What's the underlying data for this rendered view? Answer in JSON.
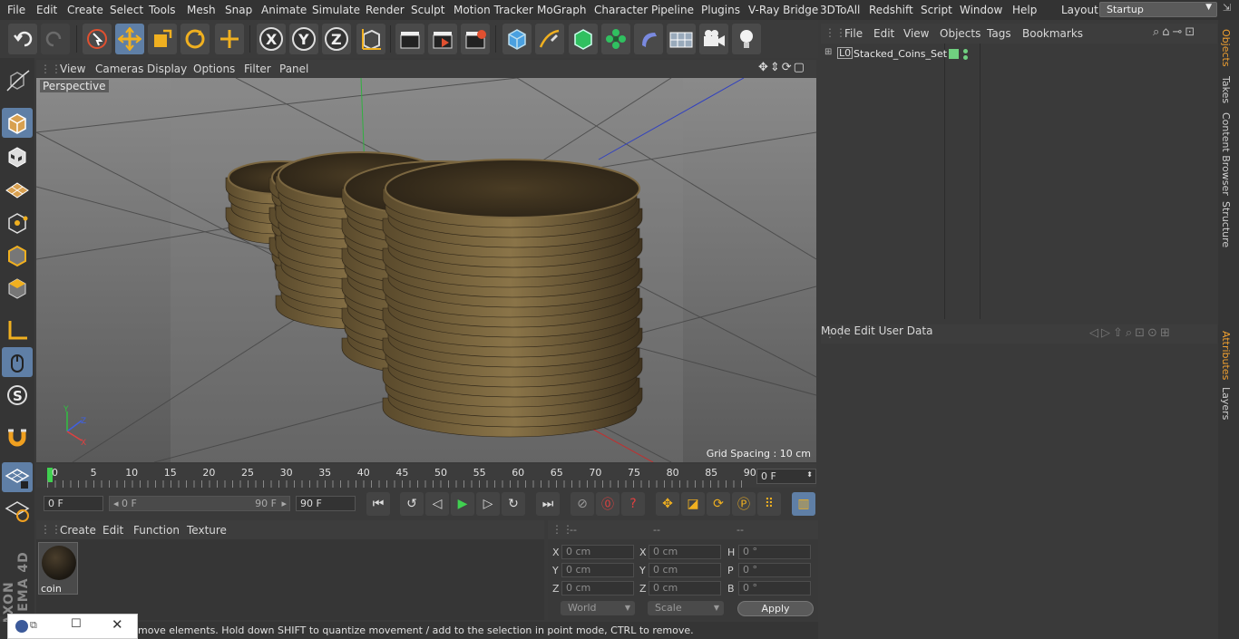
{
  "menu": [
    "File",
    "Edit",
    "Create",
    "Select",
    "Tools",
    "Mesh",
    "Snap",
    "Animate",
    "Simulate",
    "Render",
    "Sculpt",
    "Motion Tracker",
    "MoGraph",
    "Character",
    "Pipeline",
    "Plugins",
    "V-Ray Bridge",
    "3DToAll",
    "Redshift",
    "Script",
    "Window",
    "Help"
  ],
  "layout": {
    "label": "Layout:",
    "value": "Startup"
  },
  "viewport": {
    "menu": [
      "View",
      "Cameras",
      "Display",
      "Options",
      "Filter",
      "Panel"
    ],
    "label": "Perspective",
    "grid_spacing": "Grid Spacing : 10 cm"
  },
  "timeline": {
    "ticks": [
      "0",
      "5",
      "10",
      "15",
      "20",
      "25",
      "30",
      "35",
      "40",
      "45",
      "50",
      "55",
      "60",
      "65",
      "70",
      "75",
      "80",
      "85",
      "90"
    ],
    "current_frame": "0 F"
  },
  "controls": {
    "start": "0 F",
    "range_start": "0 F",
    "range_end": "90 F",
    "end": "90 F"
  },
  "material_manager": {
    "menu": [
      "Create",
      "Edit",
      "Function",
      "Texture"
    ],
    "material_name": "coin"
  },
  "coordinates": {
    "headers": [
      "--",
      "--",
      "--"
    ],
    "rows": [
      {
        "a": "X",
        "av": "0 cm",
        "b": "X",
        "bv": "0 cm",
        "c": "H",
        "cv": "0 °"
      },
      {
        "a": "Y",
        "av": "0 cm",
        "b": "Y",
        "bv": "0 cm",
        "c": "P",
        "cv": "0 °"
      },
      {
        "a": "Z",
        "av": "0 cm",
        "b": "Z",
        "bv": "0 cm",
        "c": "B",
        "cv": "0 °"
      }
    ],
    "world": "World",
    "scale": "Scale",
    "apply": "Apply"
  },
  "object_manager": {
    "menu": [
      "File",
      "Edit",
      "View",
      "Objects",
      "Tags",
      "Bookmarks"
    ],
    "object_name": "Stacked_Coins_Set"
  },
  "attribute_manager": {
    "menu": [
      "Mode",
      "Edit",
      "User Data"
    ]
  },
  "right_tabs": [
    "Objects",
    "Takes",
    "Content Browser",
    "Structure",
    "Attributes",
    "Layers"
  ],
  "status": "move elements. Hold down SHIFT to quantize movement / add to the selection in point mode, CTRL to remove.",
  "branding": "MAXON CINEMA 4D",
  "colors": {
    "accent": "#5f7fa6",
    "coin": "#5c4a2c",
    "tab_active": "#f0a030"
  }
}
